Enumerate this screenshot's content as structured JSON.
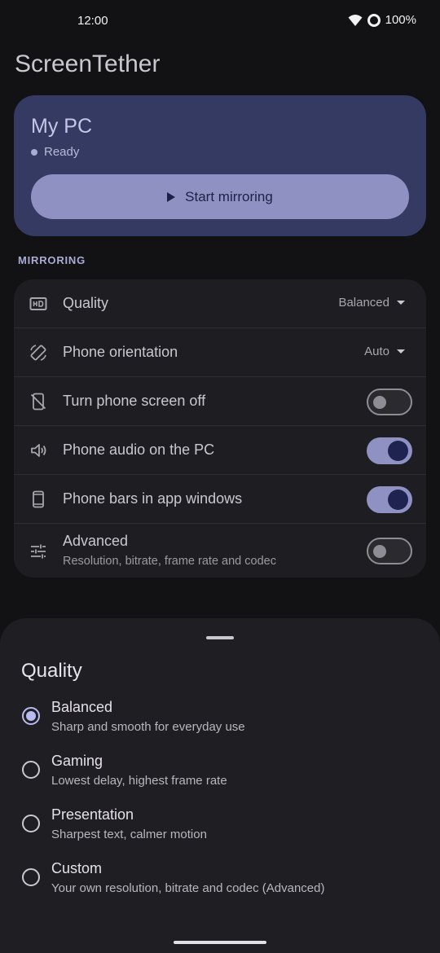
{
  "status_bar": {
    "time": "12:00",
    "battery": "100%"
  },
  "app": {
    "title": "ScreenTether"
  },
  "device": {
    "name": "My PC",
    "status": "Ready",
    "start_label": "Start mirroring"
  },
  "section": {
    "label": "MIRRORING"
  },
  "settings": {
    "quality": {
      "label": "Quality",
      "value": "Balanced",
      "icon": "hd-icon"
    },
    "orientation": {
      "label": "Phone orientation",
      "value": "Auto",
      "icon": "screen-rotation-icon"
    },
    "screen_off": {
      "label": "Turn phone screen off",
      "enabled": false,
      "icon": "phone-off-icon"
    },
    "audio": {
      "label": "Phone audio on the PC",
      "enabled": true,
      "icon": "speaker-icon"
    },
    "bars": {
      "label": "Phone bars in app windows",
      "enabled": true,
      "icon": "phone-icon"
    },
    "advanced": {
      "label": "Advanced",
      "subtitle": "Resolution, bitrate, frame rate and codec",
      "enabled": false,
      "icon": "tune-icon"
    }
  },
  "sheet": {
    "title": "Quality",
    "options": [
      {
        "title": "Balanced",
        "description": "Sharp and smooth for everyday use",
        "selected": true
      },
      {
        "title": "Gaming",
        "description": "Lowest delay, highest frame rate",
        "selected": false
      },
      {
        "title": "Presentation",
        "description": "Sharpest text, calmer motion",
        "selected": false
      },
      {
        "title": "Custom",
        "description": "Your own resolution, bitrate and codec (Advanced)",
        "selected": false
      }
    ]
  },
  "colors": {
    "accent": "#8f91c2",
    "card": "#353a62",
    "background": "#121214"
  }
}
